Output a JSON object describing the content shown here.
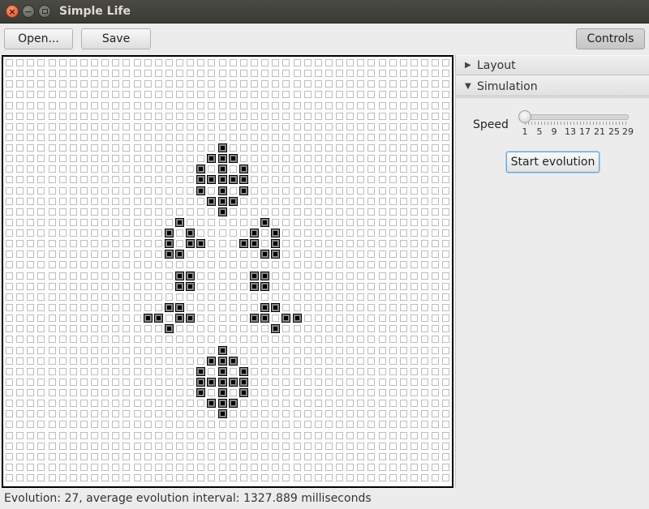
{
  "window": {
    "title": "Simple Life",
    "close_glyph": "×",
    "min_glyph": "−"
  },
  "toolbar": {
    "open_label": "Open...",
    "save_label": "Save",
    "controls_label": "Controls"
  },
  "board": {
    "columns": 42,
    "rows": 40,
    "alive_cells": [
      [
        20,
        8
      ],
      [
        19,
        9
      ],
      [
        20,
        9
      ],
      [
        21,
        9
      ],
      [
        18,
        10
      ],
      [
        20,
        10
      ],
      [
        22,
        10
      ],
      [
        18,
        11
      ],
      [
        19,
        11
      ],
      [
        20,
        11
      ],
      [
        21,
        11
      ],
      [
        22,
        11
      ],
      [
        18,
        12
      ],
      [
        20,
        12
      ],
      [
        22,
        12
      ],
      [
        19,
        13
      ],
      [
        20,
        13
      ],
      [
        21,
        13
      ],
      [
        20,
        14
      ],
      [
        16,
        15
      ],
      [
        24,
        15
      ],
      [
        15,
        16
      ],
      [
        17,
        16
      ],
      [
        23,
        16
      ],
      [
        25,
        16
      ],
      [
        15,
        17
      ],
      [
        17,
        17
      ],
      [
        18,
        17
      ],
      [
        22,
        17
      ],
      [
        23,
        17
      ],
      [
        25,
        17
      ],
      [
        15,
        18
      ],
      [
        16,
        18
      ],
      [
        24,
        18
      ],
      [
        25,
        18
      ],
      [
        16,
        20
      ],
      [
        17,
        20
      ],
      [
        23,
        20
      ],
      [
        24,
        20
      ],
      [
        16,
        21
      ],
      [
        17,
        21
      ],
      [
        23,
        21
      ],
      [
        24,
        21
      ],
      [
        15,
        23
      ],
      [
        16,
        23
      ],
      [
        24,
        23
      ],
      [
        25,
        23
      ],
      [
        13,
        24
      ],
      [
        14,
        24
      ],
      [
        16,
        24
      ],
      [
        17,
        24
      ],
      [
        23,
        24
      ],
      [
        24,
        24
      ],
      [
        26,
        24
      ],
      [
        27,
        24
      ],
      [
        15,
        25
      ],
      [
        25,
        25
      ],
      [
        20,
        27
      ],
      [
        19,
        28
      ],
      [
        20,
        28
      ],
      [
        21,
        28
      ],
      [
        18,
        29
      ],
      [
        20,
        29
      ],
      [
        22,
        29
      ],
      [
        18,
        30
      ],
      [
        19,
        30
      ],
      [
        20,
        30
      ],
      [
        21,
        30
      ],
      [
        22,
        30
      ],
      [
        18,
        31
      ],
      [
        20,
        31
      ],
      [
        22,
        31
      ],
      [
        19,
        32
      ],
      [
        20,
        32
      ],
      [
        21,
        32
      ],
      [
        20,
        33
      ]
    ]
  },
  "side_panel": {
    "sections": [
      {
        "label": "Layout",
        "expanded": false
      },
      {
        "label": "Simulation",
        "expanded": true
      }
    ],
    "speed": {
      "label": "Speed",
      "value": 1,
      "min": 1,
      "max": 29,
      "tick_labels": [
        "1",
        "5",
        "9",
        "13",
        "17",
        "21",
        "25",
        "29"
      ]
    },
    "start_button_label": "Start evolution"
  },
  "status": {
    "text": "Evolution: 27, average evolution interval: 1327.889 milliseconds"
  },
  "colors": {
    "titlebar": "#3b3a36",
    "close_button": "#e0522a",
    "alive_cell": "#000000",
    "dead_cell_border": "#bdbdbd",
    "focus_ring": "#6aa4d8"
  },
  "icons": {
    "close": "close-icon",
    "minimize": "minimize-icon",
    "maximize": "maximize-icon",
    "collapsed_arrow": "triangle-right-icon",
    "expanded_arrow": "triangle-down-icon"
  }
}
